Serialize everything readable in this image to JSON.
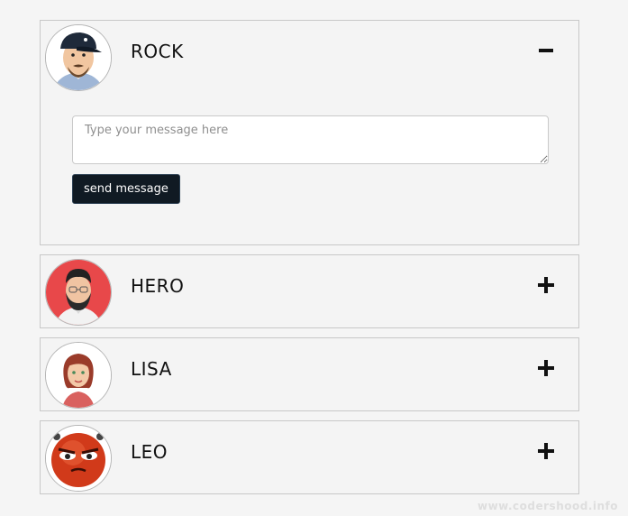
{
  "contacts": [
    {
      "name": "ROCK",
      "expanded": true,
      "toggle_icon": "minus-icon",
      "avatar_icon": "man-cap-avatar-icon"
    },
    {
      "name": "HERO",
      "expanded": false,
      "toggle_icon": "plus-icon",
      "avatar_icon": "man-beard-avatar-icon"
    },
    {
      "name": "LISA",
      "expanded": false,
      "toggle_icon": "plus-icon",
      "avatar_icon": "woman-avatar-icon"
    },
    {
      "name": "LEO",
      "expanded": false,
      "toggle_icon": "plus-icon",
      "avatar_icon": "angry-emoji-avatar-icon"
    }
  ],
  "message_form": {
    "placeholder": "Type your message here",
    "value": "",
    "send_label": "send message"
  },
  "watermark": "www.codershood.info",
  "colors": {
    "page_background": "#f5f5f5",
    "panel_border": "#c8c8c8",
    "button_background": "#101a23",
    "button_text": "#ffffff",
    "hero_avatar_bg": "#e8484a",
    "leo_avatar_bg": "#d13a1a"
  }
}
